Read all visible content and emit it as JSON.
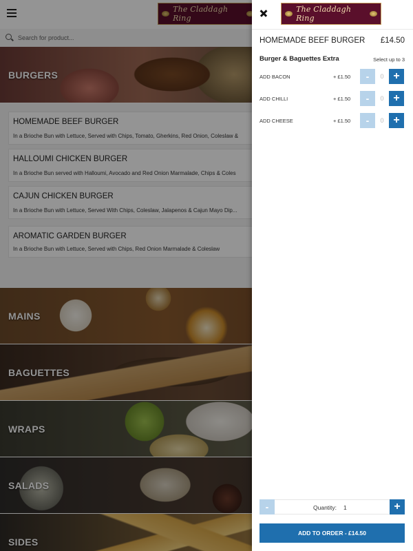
{
  "header": {
    "logo_text": "The Claddagh Ring"
  },
  "search": {
    "placeholder": "Search for product..."
  },
  "categories": [
    {
      "label": "BURGERS"
    },
    {
      "label": "MAINS"
    },
    {
      "label": "BAGUETTES"
    },
    {
      "label": "WRAPS"
    },
    {
      "label": "SALADS"
    },
    {
      "label": "SIDES"
    }
  ],
  "items": [
    {
      "title": "HOMEMADE BEEF BURGER",
      "desc": "In a Brioche Bun with Lettuce, Served with Chips, Tomato, Gherkins, Red Onion, Coleslaw &"
    },
    {
      "title": "HALLOUMI CHICKEN BURGER",
      "desc": "In a Brioche Bun served with Halloumi, Avocado and Red Onion Marmalade, Chips & Coles"
    },
    {
      "title": "CAJUN CHICKEN BURGER",
      "desc": "In a Brioche Bun with Lettuce, Served With Chips, Coleslaw, Jalapenos & Cajun Mayo Dip..."
    },
    {
      "title": "AROMATIC GARDEN BURGER",
      "desc": "In a Brioche Bun with Lettuce, Served with Chips, Red Onion Marmalade & Coleslaw"
    }
  ],
  "drawer": {
    "logo_text": "The Claddagh Ring",
    "product_name": "HOMEMADE BEEF BURGER",
    "product_price": "£14.50",
    "extras_group": "Burger & Baguettes Extra",
    "extras_hint": "Select up to 3",
    "extras": [
      {
        "name": "ADD BACON",
        "price": "+ £1.50",
        "qty": "0"
      },
      {
        "name": "ADD CHILLI",
        "price": "+ £1.50",
        "qty": "0"
      },
      {
        "name": "ADD CHEESE",
        "price": "+ £1.50",
        "qty": "0"
      }
    ],
    "minus_symbol": "-",
    "plus_symbol": "+",
    "quantity_label": "Quantity:",
    "quantity_value": "1",
    "add_to_order": "ADD TO ORDER  -  £14.50"
  },
  "colors": {
    "accent": "#1f6fae",
    "accent_light": "#b7d3ea",
    "logo_bg": "#5a0f2b"
  }
}
